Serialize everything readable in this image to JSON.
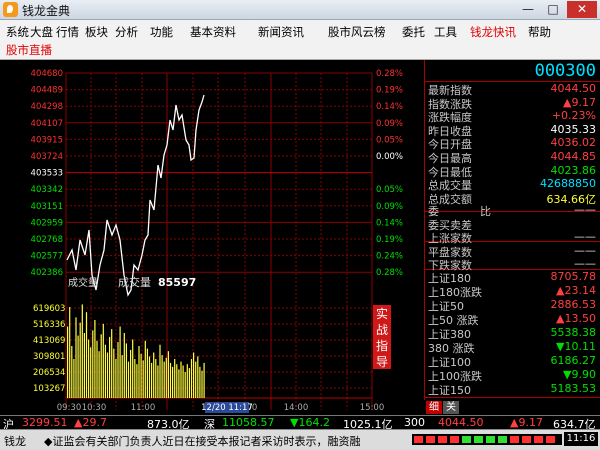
{
  "window": {
    "title": "钱龙金典"
  },
  "menu": {
    "row1": [
      "系统",
      "大盘",
      "行情",
      "板块",
      "分析",
      "功能",
      "基本资料",
      "新闻资讯",
      "股市风云榜",
      "委托",
      "工具",
      "钱龙快讯",
      "帮助"
    ],
    "row1_active": "钱龙快讯",
    "row2": [
      "股市直播"
    ]
  },
  "chart": {
    "price_ticks": [
      "404680",
      "404489",
      "404298",
      "404107",
      "403915",
      "403724",
      "403533",
      "403342",
      "403151",
      "402959",
      "402768",
      "402577",
      "402386"
    ],
    "pct_ticks": [
      "0.28%",
      "0.19%",
      "0.14%",
      "0.09%",
      "0.05%",
      "0.00%",
      "0.05%",
      "0.09%",
      "0.14%",
      "0.19%",
      "0.24%",
      "0.28%"
    ],
    "volume_label_left": "成交量",
    "volume_label": "成交量",
    "volume_value": "85597",
    "volume_ticks": [
      "619603",
      "516336",
      "413069",
      "309801",
      "206534",
      "103267"
    ],
    "time_ticks": [
      "09:30",
      "10:30",
      "11:00",
      "13:00",
      "14:00",
      "15:00"
    ],
    "time_highlight": "12/20 11:17",
    "side_button": [
      "实",
      "战",
      "指",
      "导"
    ],
    "price_colors": {
      "up": "#ff3030",
      "flat": "#ffffff",
      "down": "#00e000"
    }
  },
  "quote": {
    "code": "000300",
    "rows": [
      {
        "label": "最新指数",
        "value": "4044.50",
        "color": "#ff4040"
      },
      {
        "label": "指数涨跌",
        "value": "▲9.17",
        "color": "#ff4040"
      },
      {
        "label": "涨跌幅度",
        "value": "+0.23%",
        "color": "#ff4040"
      },
      {
        "label": "昨日收盘",
        "value": "4035.33",
        "color": "#ffffff"
      },
      {
        "label": "今日开盘",
        "value": "4036.02",
        "color": "#ff4040"
      },
      {
        "label": "今日最高",
        "value": "4044.85",
        "color": "#ff4040"
      },
      {
        "label": "今日最低",
        "value": "4023.86",
        "color": "#00e000"
      },
      {
        "label": "总成交量",
        "value": "42688850",
        "color": "#00e0ff"
      },
      {
        "label": "总成交额",
        "value": "634.66亿",
        "color": "#ffff30"
      }
    ],
    "mid_rows": [
      {
        "label": "委",
        "extra": "比",
        "value": "——"
      },
      {
        "label": "委买卖差",
        "value": ""
      },
      {
        "label": "上涨家数",
        "value": "——"
      },
      {
        "label": "平盘家数",
        "value": "——"
      },
      {
        "label": "下跌家数",
        "value": "——"
      }
    ],
    "index_rows": [
      {
        "label": "上证180",
        "value": "8705.78",
        "color": "#ff4040"
      },
      {
        "label": "上180涨跌",
        "value": "▲23.14",
        "color": "#ff4040"
      },
      {
        "label": "上证50",
        "value": "2886.53",
        "color": "#ff4040"
      },
      {
        "label": "上50 涨跌",
        "value": "▲13.50",
        "color": "#ff4040"
      },
      {
        "label": "上证380",
        "value": "5538.38",
        "color": "#00e000"
      },
      {
        "label": "380 涨跌",
        "value": "▼10.11",
        "color": "#00e000"
      },
      {
        "label": "上证100",
        "value": "6186.27",
        "color": "#00e000"
      },
      {
        "label": "上100涨跌",
        "value": "▼9.90",
        "color": "#00e000"
      },
      {
        "label": "上证150",
        "value": "5183.53",
        "color": "#00e000"
      }
    ],
    "tabs": [
      "细",
      "关"
    ]
  },
  "status": {
    "sh_label": "沪",
    "sh_value": "3299.51",
    "sh_change": "▲29.7",
    "sh_amount": "873.0亿",
    "sz_label": "深",
    "sz_value": "11058.57",
    "sz_change": "▼164.2",
    "sz_amount": "1025.1亿",
    "idx_label": "300",
    "idx_value": "4044.50",
    "idx_change": "▲9.17",
    "idx_amount": "634.7亿",
    "ticker_label": "钱龙",
    "ticker": "◆证监会有关部门负责人近日在接受本报记者采访时表示，融资融",
    "clock": "11:16"
  }
}
